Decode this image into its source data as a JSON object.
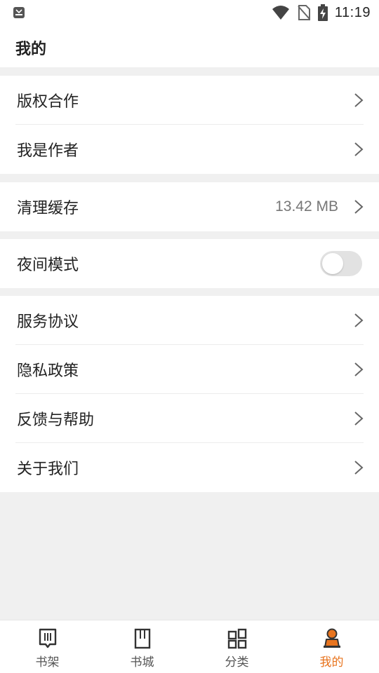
{
  "status_bar": {
    "time": "11:19"
  },
  "header": {
    "title": "我的"
  },
  "sections": {
    "copyright": {
      "label": "版权合作"
    },
    "author": {
      "label": "我是作者"
    },
    "cache": {
      "label": "清理缓存",
      "value": "13.42 MB"
    },
    "night_mode": {
      "label": "夜间模式",
      "enabled": false
    },
    "terms": {
      "label": "服务协议"
    },
    "privacy": {
      "label": "隐私政策"
    },
    "feedback": {
      "label": "反馈与帮助"
    },
    "about": {
      "label": "关于我们"
    }
  },
  "bottom_nav": {
    "bookshelf": {
      "label": "书架",
      "icon": "bookshelf-icon"
    },
    "bookstore": {
      "label": "书城",
      "icon": "book-icon"
    },
    "category": {
      "label": "分类",
      "icon": "grid-icon"
    },
    "mine": {
      "label": "我的",
      "icon": "person-icon",
      "active": true
    }
  },
  "colors": {
    "accent": "#e8741e",
    "background": "#f0f0f0",
    "text": "#222222",
    "secondary_text": "#777777"
  }
}
